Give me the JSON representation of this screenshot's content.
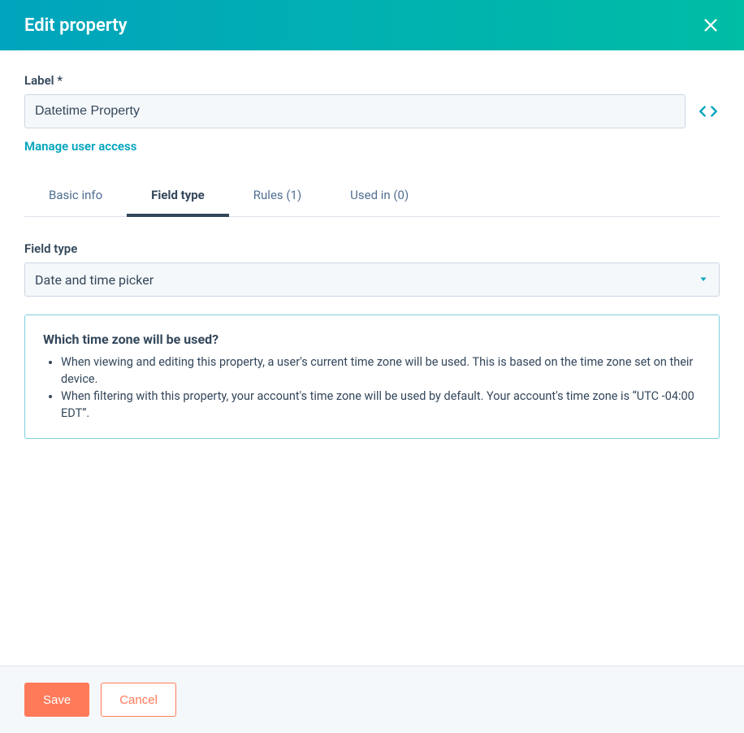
{
  "header": {
    "title": "Edit property"
  },
  "form": {
    "label_field_label": "Label *",
    "label_value": "Datetime Property",
    "manage_user_access": "Manage user access"
  },
  "tabs": {
    "basic_info": "Basic info",
    "field_type": "Field type",
    "rules": "Rules (1)",
    "used_in": "Used in (0)"
  },
  "field_type": {
    "label": "Field type",
    "selected": "Date and time picker"
  },
  "info": {
    "heading": "Which time zone will be used?",
    "bullet1": "When viewing and editing this property, a user's current time zone will be used. This is based on the time zone set on their device.",
    "bullet2": "When filtering with this property, your account's time zone will be used by default. Your account's time zone is “UTC -04:00 EDT”."
  },
  "footer": {
    "save": "Save",
    "cancel": "Cancel"
  }
}
